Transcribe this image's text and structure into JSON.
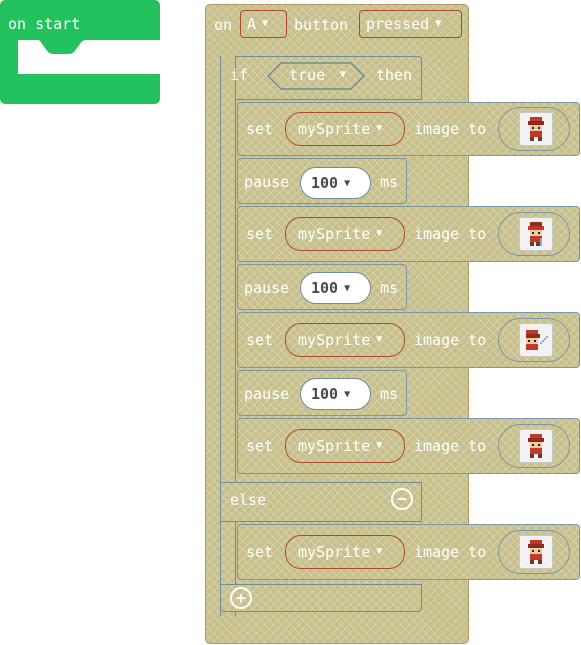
{
  "on_start": {
    "label": "on start"
  },
  "event": {
    "on_label": "on",
    "button_value": "A",
    "button_label": "button",
    "action_value": "pressed"
  },
  "if_block": {
    "if_label": "if",
    "condition": "true",
    "then_label": "then",
    "else_label": "else"
  },
  "statements": [
    {
      "type": "set",
      "set_label": "set",
      "variable": "mySprite",
      "image_to_label": "image to",
      "sprite_icon": "sprite-walk-down-icon"
    },
    {
      "type": "pause",
      "pause_label": "pause",
      "value": "100",
      "unit": "ms"
    },
    {
      "type": "set",
      "set_label": "set",
      "variable": "mySprite",
      "image_to_label": "image to",
      "sprite_icon": "sprite-attack-icon"
    },
    {
      "type": "pause",
      "pause_label": "pause",
      "value": "100",
      "unit": "ms"
    },
    {
      "type": "set",
      "set_label": "set",
      "variable": "mySprite",
      "image_to_label": "image to",
      "sprite_icon": "sprite-sword-icon"
    },
    {
      "type": "pause",
      "pause_label": "pause",
      "value": "100",
      "unit": "ms"
    },
    {
      "type": "set",
      "set_label": "set",
      "variable": "mySprite",
      "image_to_label": "image to",
      "sprite_icon": "sprite-idle-icon"
    }
  ],
  "else_statement": {
    "set_label": "set",
    "variable": "mySprite",
    "image_to_label": "image to",
    "sprite_icon": "sprite-idle-icon"
  },
  "colors": {
    "on_start_green": "#23c25f",
    "block_khaki": "#c7c08c",
    "dropdown_border": "#b24a2e",
    "number_border": "#6c8f9b"
  },
  "icons": {
    "caret": "▼",
    "else_remove": "remove-circle-icon",
    "add": "add-circle-icon"
  }
}
